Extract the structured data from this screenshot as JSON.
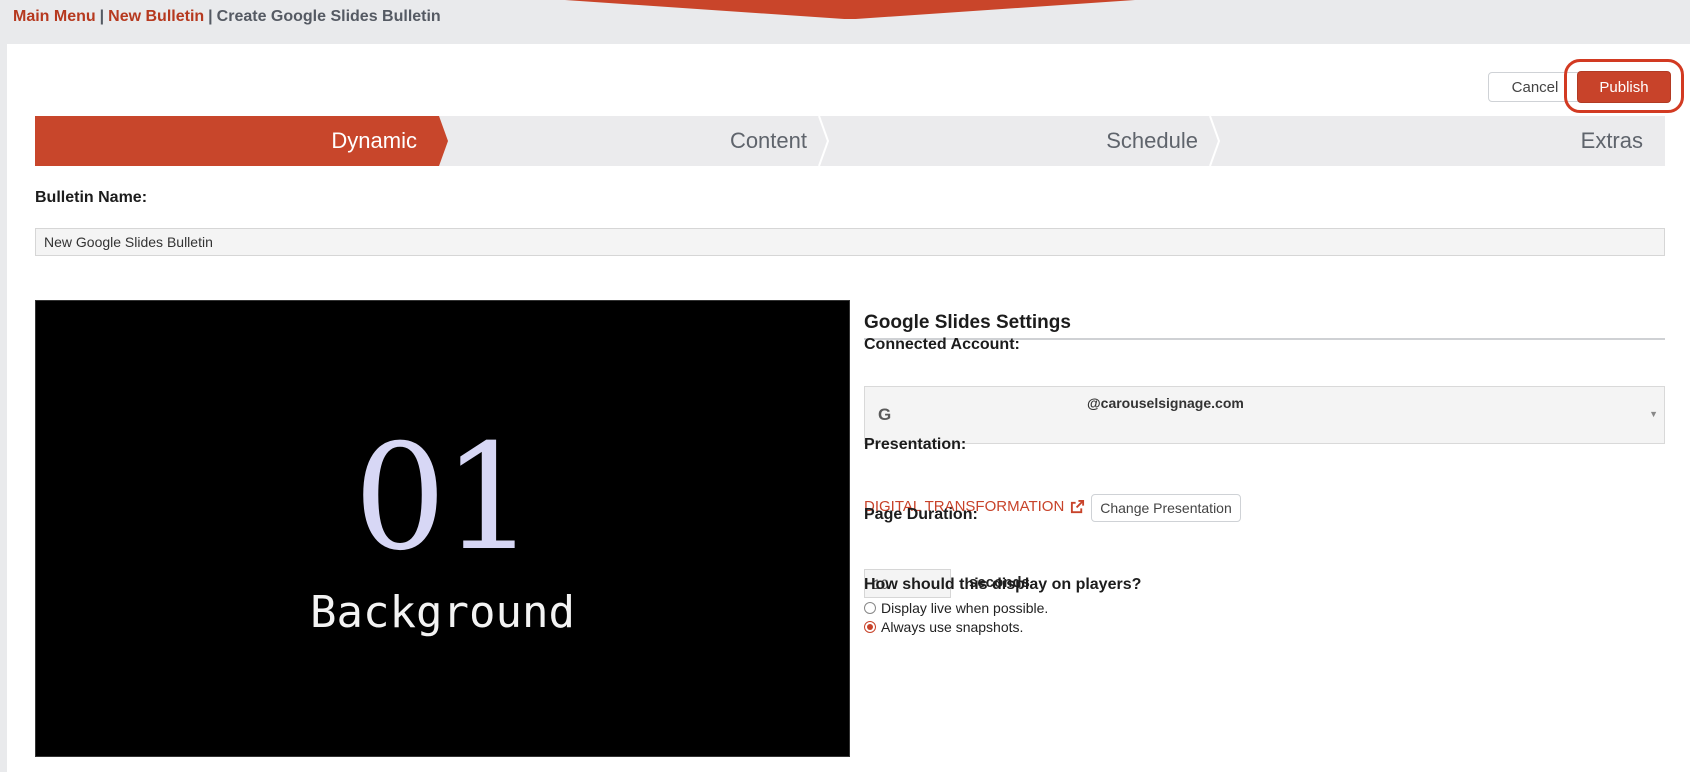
{
  "breadcrumb": {
    "main_menu": "Main Menu",
    "new_bulletin": "New Bulletin",
    "current": "Create Google Slides Bulletin",
    "separator": "|"
  },
  "actions": {
    "cancel_label": "Cancel",
    "publish_label": "Publish"
  },
  "steps": [
    {
      "label": "Dynamic",
      "active": true
    },
    {
      "label": "Content",
      "active": false
    },
    {
      "label": "Schedule",
      "active": false
    },
    {
      "label": "Extras",
      "active": false
    }
  ],
  "bulletin": {
    "name_label": "Bulletin Name:",
    "name_value": "New Google Slides Bulletin"
  },
  "preview": {
    "slide_number": "01",
    "slide_title": "Background"
  },
  "settings": {
    "title": "Google Slides Settings",
    "account_label": "Connected Account:",
    "account_icon": "G",
    "account_email": "@carouselsignage.com",
    "presentation_label": "Presentation:",
    "presentation_name": "DIGITAL TRANSFORMATION",
    "change_presentation_label": "Change Presentation",
    "duration_label": "Page Duration:",
    "duration_value": "10",
    "duration_unit": "seconds",
    "display_question": "How should this display on players?",
    "display_options": [
      {
        "label": "Display live when possible.",
        "checked": false
      },
      {
        "label": "Always use snapshots.",
        "checked": true
      }
    ]
  },
  "colors": {
    "accent": "#c8432a",
    "link": "#b6391f",
    "background": "#e9eaec"
  }
}
